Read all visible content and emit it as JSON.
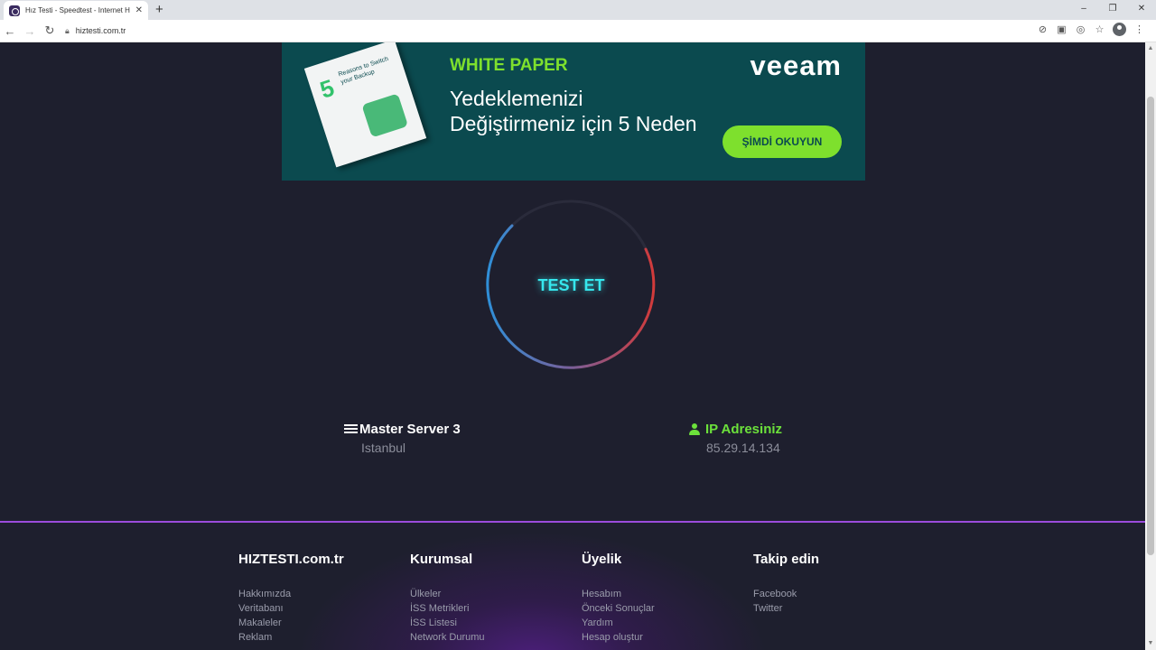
{
  "browser": {
    "tab_title": "Hız Testi - Speedtest - Internet H",
    "url": "hiztesti.com.tr",
    "window_controls": [
      "–",
      "❐",
      "✕"
    ]
  },
  "ad": {
    "book_number": "5",
    "book_text": "Reasons to Switch your Backup",
    "kicker": "WHITE PAPER",
    "headline_line1": "Yedeklemenizi",
    "headline_line2": "Değiştirmeniz için 5 Neden",
    "logo": "veeam",
    "cta": "ŞİMDİ OKUYUN",
    "colors": {
      "background": "#0b4a4f",
      "accent": "#7ee02d"
    }
  },
  "speedtest": {
    "button_label": "TEST ET",
    "server": {
      "title": "Master Server 3",
      "location": "Istanbul"
    },
    "ip": {
      "title": "IP Adresiniz",
      "address": "85.29.14.134"
    },
    "colors": {
      "button_glow": "#36e7ee",
      "ip_accent": "#6ce13b"
    }
  },
  "footer": {
    "columns": [
      {
        "title": "HIZTESTI.com.tr",
        "links": [
          "Hakkımızda",
          "Veritabanı",
          "Makaleler",
          "Reklam"
        ]
      },
      {
        "title": "Kurumsal",
        "links": [
          "Ülkeler",
          "İSS Metrikleri",
          "İSS Listesi",
          "Network Durumu"
        ]
      },
      {
        "title": "Üyelik",
        "links": [
          "Hesabım",
          "Önceki Sonuçlar",
          "Yardım",
          "Hesap oluştur"
        ]
      },
      {
        "title": "Takip edin",
        "links": [
          "Facebook",
          "Twitter"
        ]
      }
    ]
  }
}
